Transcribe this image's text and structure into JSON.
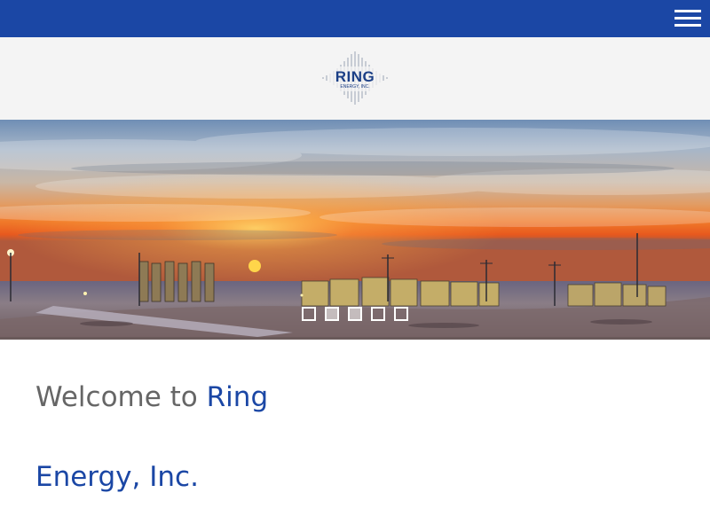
{
  "header": {
    "menu_icon": "hamburger-menu-icon",
    "brand_color": "#1b47a5"
  },
  "logo": {
    "title": "RING",
    "subtitle": "ENERGY, INC.",
    "icon": "soundwave-ring-icon"
  },
  "hero": {
    "slides_total": 5,
    "active_slide": 2
  },
  "content": {
    "welcome_prefix": "Welcome to ",
    "welcome_brand": "Ring",
    "company_line": "Energy, Inc."
  }
}
